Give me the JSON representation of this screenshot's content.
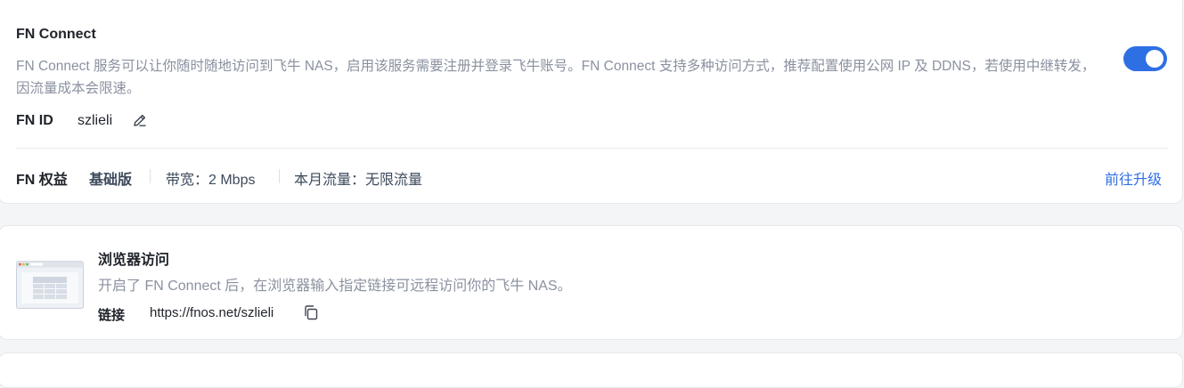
{
  "fn_connect": {
    "title": "FN Connect",
    "description": "FN Connect 服务可以让你随时随地访问到飞牛 NAS，启用该服务需要注册并登录飞牛账号。FN Connect 支持多种访问方式，推荐配置使用公网 IP 及 DDNS，若使用中继转发，因流量成本会限速。",
    "enabled": true,
    "toggle_color": "#2f6fe4",
    "fn_id_label": "FN ID",
    "fn_id_value": "szlieli",
    "edit_icon": "pencil-icon"
  },
  "rights": {
    "label": "FN 权益",
    "tier": "基础版",
    "bandwidth": "带宽：2 Mbps",
    "traffic": "本月流量：无限流量",
    "upgrade_link": "前往升级",
    "link_color": "#2f6fe4"
  },
  "browser_access": {
    "title": "浏览器访问",
    "description": "开启了 FN Connect 后，在浏览器输入指定链接可远程访问你的飞牛 NAS。",
    "link_label": "链接",
    "link_value": "https://fnos.net/szlieli",
    "copy_icon": "copy-icon",
    "illustration": "browser-window-icon"
  }
}
